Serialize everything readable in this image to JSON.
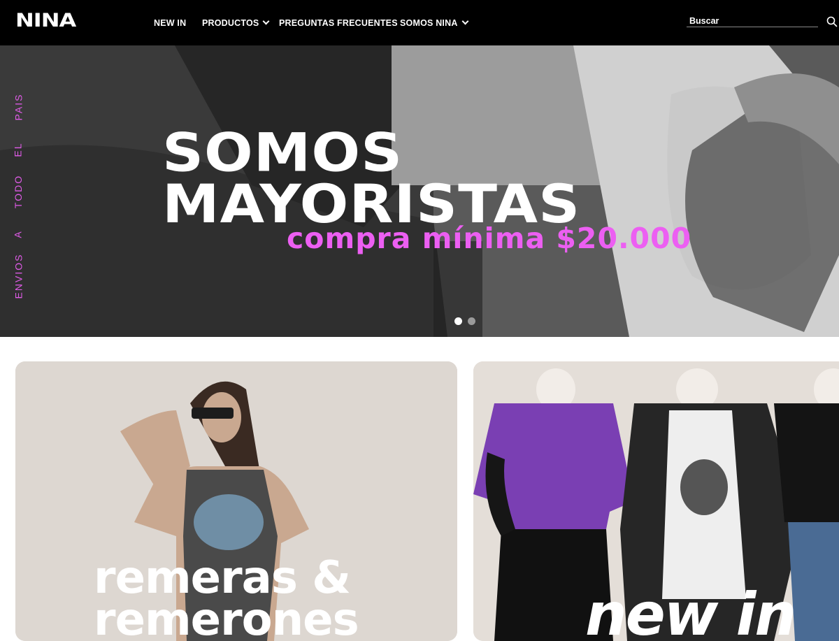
{
  "header": {
    "logo": "NINA",
    "nav": [
      {
        "label": "NEW IN",
        "has_dropdown": false
      },
      {
        "label": "PRODUCTOS",
        "has_dropdown": true
      },
      {
        "label": "PREGUNTAS FRECUENTES",
        "has_dropdown": false
      },
      {
        "label": "SOMOS NINA",
        "has_dropdown": true
      }
    ],
    "search": {
      "placeholder": "Buscar",
      "value": "",
      "icon": "search-icon"
    }
  },
  "hero": {
    "vertical_text": [
      "ENVIOS",
      "A",
      "TODO",
      "EL",
      "PAIS"
    ],
    "title_line1": "SOMOS",
    "title_line2": "MAYORISTAS",
    "subtitle": "compra mínima $20.000",
    "slide_count": 2,
    "active_slide": 1,
    "accent_color": "#ec5ff2"
  },
  "categories": [
    {
      "line1": "remeras &",
      "line2": "remerones"
    },
    {
      "line1": "new in"
    }
  ]
}
